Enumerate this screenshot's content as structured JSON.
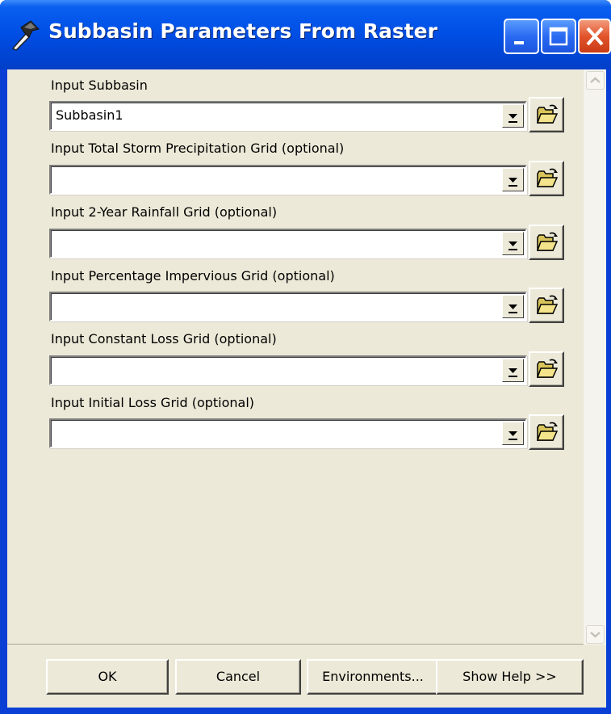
{
  "window": {
    "title": "Subbasin Parameters From Raster",
    "app_icon": "hammer-icon",
    "title_buttons": [
      "minimize-icon",
      "maximize-icon",
      "close-icon"
    ],
    "title_bar_color": "#0050e6",
    "client_color": "#ece9d8"
  },
  "params": [
    {
      "label": "Input Subbasin",
      "value": "Subbasin1"
    },
    {
      "label": "Input Total Storm Precipitation Grid (optional)",
      "value": ""
    },
    {
      "label": "Input 2-Year Rainfall Grid (optional)",
      "value": ""
    },
    {
      "label": "Input Percentage Impervious Grid (optional)",
      "value": ""
    },
    {
      "label": "Input Constant Loss Grid (optional)",
      "value": ""
    },
    {
      "label": "Input Initial Loss Grid (optional)",
      "value": ""
    }
  ],
  "icons": {
    "dropdown": "chevron-down-icon",
    "browse": "open-folder-icon"
  },
  "buttons": {
    "ok": "OK",
    "cancel": "Cancel",
    "environments": "Environments...",
    "help": "Show Help >>"
  }
}
